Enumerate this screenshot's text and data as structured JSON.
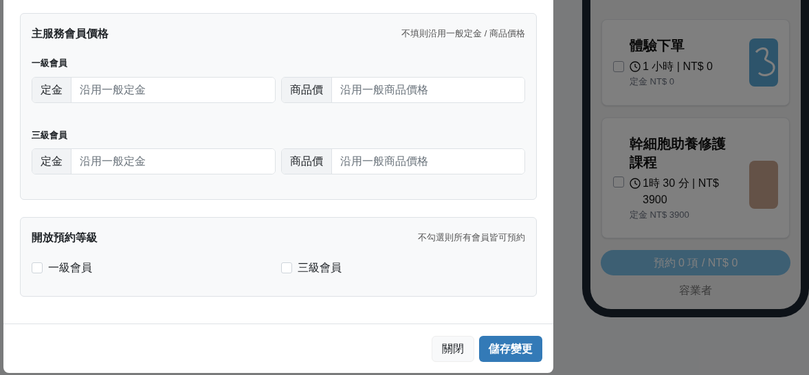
{
  "background": {
    "services": [
      {
        "name": "體驗下單",
        "checked": false,
        "duration": "1 小時 | NT$ 0",
        "deposit": "定金 NT$ 0",
        "kind": "logo"
      },
      {
        "name": "幹細胞助養修護課程",
        "checked": false,
        "duration": "1時 30 分 | NT$ 3900",
        "deposit": "定金 NT$ 3900",
        "kind": "photo"
      }
    ],
    "book_button": "預約 0 項 / NT$ 0",
    "footer": "容業者"
  },
  "modal": {
    "price_panel": {
      "title": "主服務會員價格",
      "hint": "不填則沿用一般定金 / 商品價格",
      "levels": [
        {
          "label": "一級會員",
          "deposit": {
            "addon": "定金",
            "placeholder": "沿用一般定金"
          },
          "price": {
            "addon": "商品價",
            "placeholder": "沿用一般商品價格"
          }
        },
        {
          "label": "三級會員",
          "deposit": {
            "addon": "定金",
            "placeholder": "沿用一般定金"
          },
          "price": {
            "addon": "商品價",
            "placeholder": "沿用一般商品價格"
          }
        }
      ]
    },
    "booking_panel": {
      "title": "開放預約等級",
      "hint": "不勾選則所有會員皆可預約",
      "options": [
        {
          "label": "一級會員",
          "checked": false
        },
        {
          "label": "三級會員",
          "checked": false
        }
      ]
    },
    "buttons": [
      {
        "label": "關閉",
        "kind": "secondary"
      },
      {
        "label": "儲存變更",
        "kind": "primary"
      }
    ]
  }
}
